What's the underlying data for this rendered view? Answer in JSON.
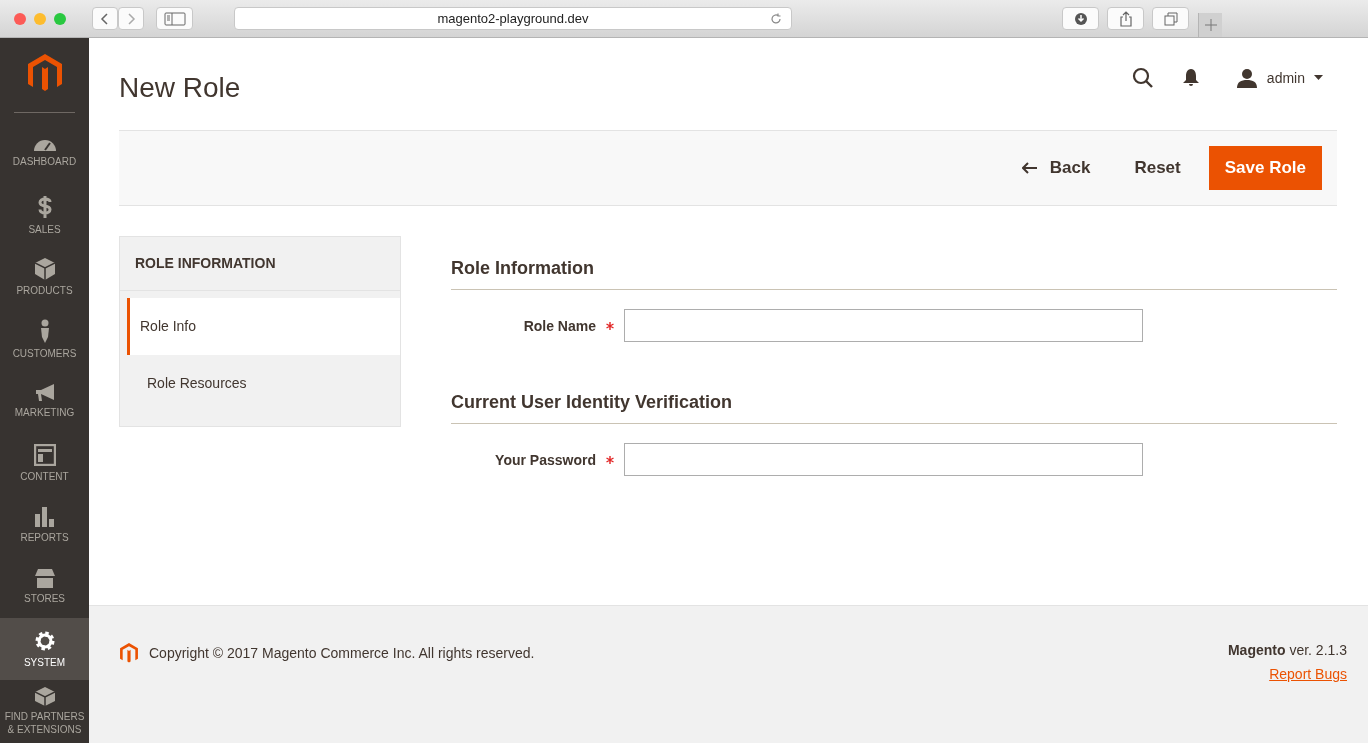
{
  "browser": {
    "url": "magento2-playground.dev"
  },
  "nav": [
    {
      "label": "DASHBOARD",
      "selected": false
    },
    {
      "label": "SALES",
      "selected": false
    },
    {
      "label": "PRODUCTS",
      "selected": false
    },
    {
      "label": "CUSTOMERS",
      "selected": false
    },
    {
      "label": "MARKETING",
      "selected": false
    },
    {
      "label": "CONTENT",
      "selected": false
    },
    {
      "label": "REPORTS",
      "selected": false
    },
    {
      "label": "STORES",
      "selected": false
    },
    {
      "label": "SYSTEM",
      "selected": true
    },
    {
      "label": "FIND PARTNERS & EXTENSIONS",
      "selected": false
    }
  ],
  "header": {
    "title": "New Role",
    "user": "admin"
  },
  "actions": [
    {
      "label": "Back",
      "kind": "back"
    },
    {
      "label": "Reset",
      "kind": "plain"
    },
    {
      "label": "Save Role",
      "kind": "primary"
    }
  ],
  "tabs": {
    "title": "ROLE INFORMATION",
    "items": [
      {
        "label": "Role Info",
        "selected": true
      },
      {
        "label": "Role Resources",
        "selected": false
      }
    ]
  },
  "sections": [
    {
      "title": "Role Information",
      "fields": [
        {
          "label": "Role Name",
          "required": true
        }
      ]
    },
    {
      "title": "Current User Identity Verification",
      "fields": [
        {
          "label": "Your Password",
          "required": true
        }
      ]
    }
  ],
  "footer": {
    "copyright": "Copyright © 2017 Magento Commerce Inc. All rights reserved.",
    "version": "**Magento** ver. 2.1.3",
    "link": "Report Bugs"
  }
}
